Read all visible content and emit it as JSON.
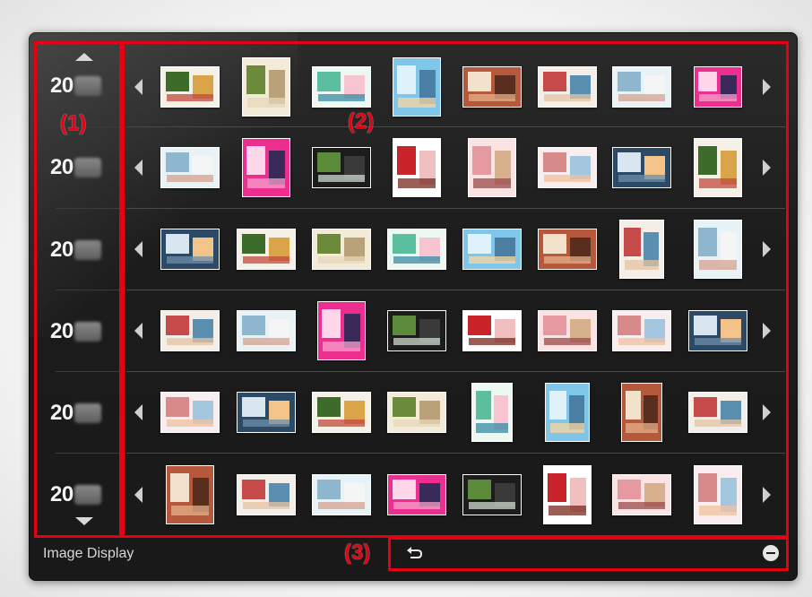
{
  "callouts": {
    "year_list": "(1)",
    "thumbnail_area": "(2)",
    "operation_panel": "(3)"
  },
  "status_bar": {
    "label": "Image Display"
  },
  "years": [
    "20",
    "20",
    "20",
    "20",
    "20",
    "20"
  ],
  "icons": {
    "scroll_up": "triangle-up-icon",
    "scroll_down": "triangle-down-icon",
    "row_prev": "triangle-left-icon",
    "row_next": "triangle-right-icon",
    "back": "return-arrow-icon",
    "collapse": "minus-circle-icon"
  },
  "colors": {
    "highlight": "#e60012",
    "window_bg": "#1c1c1c",
    "text": "#f4f4f4"
  }
}
